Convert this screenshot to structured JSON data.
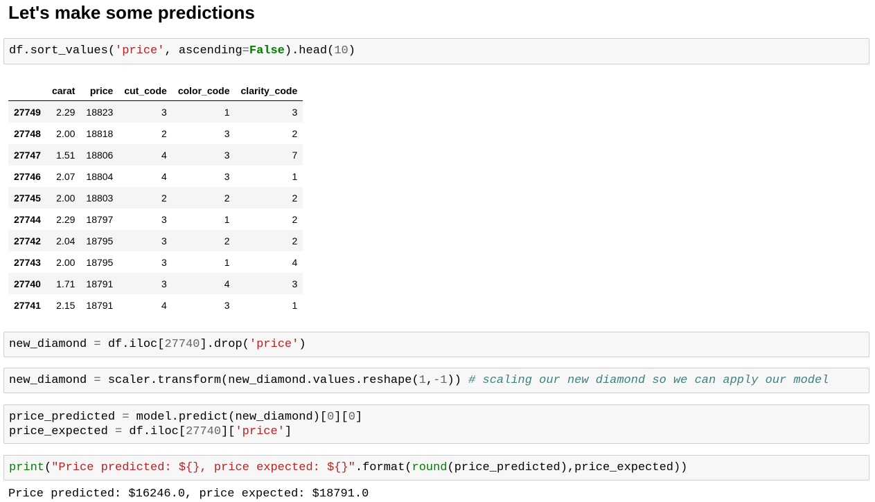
{
  "heading": "Let's make some predictions",
  "cells": {
    "sort_cell": {
      "t1": "df.sort_values(",
      "t2": "'price'",
      "t3": ", ascending",
      "t4": "=",
      "t5": "False",
      "t6": ").head(",
      "t7": "10",
      "t8": ")"
    },
    "new_diamond_cell": {
      "t1": "new_diamond ",
      "t2": "=",
      "t3": " df.iloc[",
      "t4": "27740",
      "t5": "].drop(",
      "t6": "'price'",
      "t7": ")"
    },
    "scaler_cell": {
      "t1": "new_diamond ",
      "t2": "=",
      "t3": " scaler.transform(new_diamond.values.reshape(",
      "t4": "1",
      "t5": ",",
      "t6": "-1",
      "t7": ")) ",
      "t8": "# scaling our new diamond so we can apply our model"
    },
    "predict_cell": {
      "l1a": "price_predicted ",
      "l1b": "=",
      "l1c": " model.predict(new_diamond)[",
      "l1d": "0",
      "l1e": "][",
      "l1f": "0",
      "l1g": "]",
      "l2a": "price_expected ",
      "l2b": "=",
      "l2c": " df.iloc[",
      "l2d": "27740",
      "l2e": "][",
      "l2f": "'price'",
      "l2g": "]"
    },
    "print_cell": {
      "t1": "print",
      "t2": "(",
      "t3": "\"Price predicted: ${}, price expected: ${}\"",
      "t4": ".format(",
      "t5": "round",
      "t6": "(price_predicted),price_expected))"
    }
  },
  "table": {
    "columns": [
      "",
      "carat",
      "price",
      "cut_code",
      "color_code",
      "clarity_code"
    ],
    "rows": [
      {
        "index": "27749",
        "carat": "2.29",
        "price": "18823",
        "cut_code": "3",
        "color_code": "1",
        "clarity_code": "3"
      },
      {
        "index": "27748",
        "carat": "2.00",
        "price": "18818",
        "cut_code": "2",
        "color_code": "3",
        "clarity_code": "2"
      },
      {
        "index": "27747",
        "carat": "1.51",
        "price": "18806",
        "cut_code": "4",
        "color_code": "3",
        "clarity_code": "7"
      },
      {
        "index": "27746",
        "carat": "2.07",
        "price": "18804",
        "cut_code": "4",
        "color_code": "3",
        "clarity_code": "1"
      },
      {
        "index": "27745",
        "carat": "2.00",
        "price": "18803",
        "cut_code": "2",
        "color_code": "2",
        "clarity_code": "2"
      },
      {
        "index": "27744",
        "carat": "2.29",
        "price": "18797",
        "cut_code": "3",
        "color_code": "1",
        "clarity_code": "2"
      },
      {
        "index": "27742",
        "carat": "2.04",
        "price": "18795",
        "cut_code": "3",
        "color_code": "2",
        "clarity_code": "2"
      },
      {
        "index": "27743",
        "carat": "2.00",
        "price": "18795",
        "cut_code": "3",
        "color_code": "1",
        "clarity_code": "4"
      },
      {
        "index": "27740",
        "carat": "1.71",
        "price": "18791",
        "cut_code": "3",
        "color_code": "4",
        "clarity_code": "3"
      },
      {
        "index": "27741",
        "carat": "2.15",
        "price": "18791",
        "cut_code": "4",
        "color_code": "3",
        "clarity_code": "1"
      }
    ]
  },
  "output": "Price predicted: $16246.0, price expected: $18791.0",
  "colors": {
    "string": "#ba2121",
    "keyword": "#008000",
    "number": "#666666",
    "comment": "#408080",
    "cell_background": "#f7f7f7",
    "cell_border": "#cfcfcf"
  }
}
